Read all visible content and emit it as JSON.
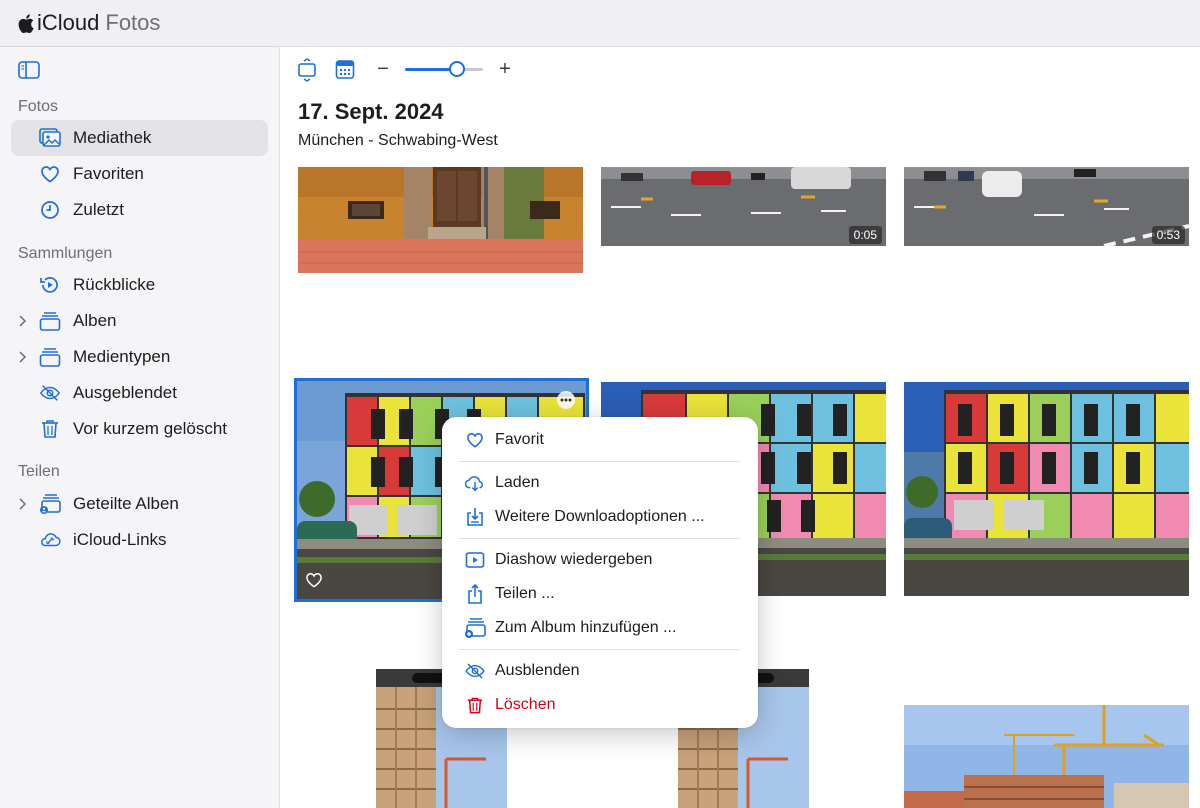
{
  "app": {
    "name_main": "iCloud",
    "name_sub": "Fotos"
  },
  "sidebar": {
    "sections": [
      {
        "title": "Fotos"
      },
      {
        "title": "Sammlungen"
      },
      {
        "title": "Teilen"
      }
    ],
    "items": [
      {
        "label": "Mediathek",
        "icon": "library-icon",
        "active": true
      },
      {
        "label": "Favoriten",
        "icon": "heart-icon"
      },
      {
        "label": "Zuletzt",
        "icon": "clock-icon"
      },
      {
        "label": "Rückblicke",
        "icon": "memories-icon"
      },
      {
        "label": "Alben",
        "icon": "albums-icon",
        "expandable": true
      },
      {
        "label": "Medientypen",
        "icon": "albums-icon",
        "expandable": true
      },
      {
        "label": "Ausgeblendet",
        "icon": "eye-slash-icon"
      },
      {
        "label": "Vor kurzem gelöscht",
        "icon": "trash-icon"
      },
      {
        "label": "Geteilte Alben",
        "icon": "shared-albums-icon",
        "expandable": true
      },
      {
        "label": "iCloud-Links",
        "icon": "cloud-link-icon"
      }
    ]
  },
  "toolbar": {
    "zoom_minus": "−",
    "zoom_plus": "+",
    "zoom_level": 0.67
  },
  "content": {
    "date": "17. Sept. 2024",
    "location": "München - Schwabing-West",
    "videos": [
      {
        "duration": "0:05"
      },
      {
        "duration": "0:53"
      }
    ]
  },
  "context_menu": {
    "items": [
      {
        "label": "Favorit",
        "icon": "heart-icon"
      },
      {
        "label": "Laden",
        "icon": "cloud-download-icon"
      },
      {
        "label": "Weitere Downloadoptionen ...",
        "icon": "download-options-icon"
      },
      {
        "label": "Diashow wiedergeben",
        "icon": "slideshow-icon"
      },
      {
        "label": "Teilen ...",
        "icon": "share-icon"
      },
      {
        "label": "Zum Album hinzufügen ...",
        "icon": "add-to-album-icon"
      },
      {
        "label": "Ausblenden",
        "icon": "eye-slash-icon"
      },
      {
        "label": "Löschen",
        "icon": "trash-icon",
        "destructive": true
      }
    ]
  },
  "colors": {
    "accent": "#1e6fd9",
    "destructive": "#d70015",
    "sidebar_bg": "#f5f5f7"
  }
}
